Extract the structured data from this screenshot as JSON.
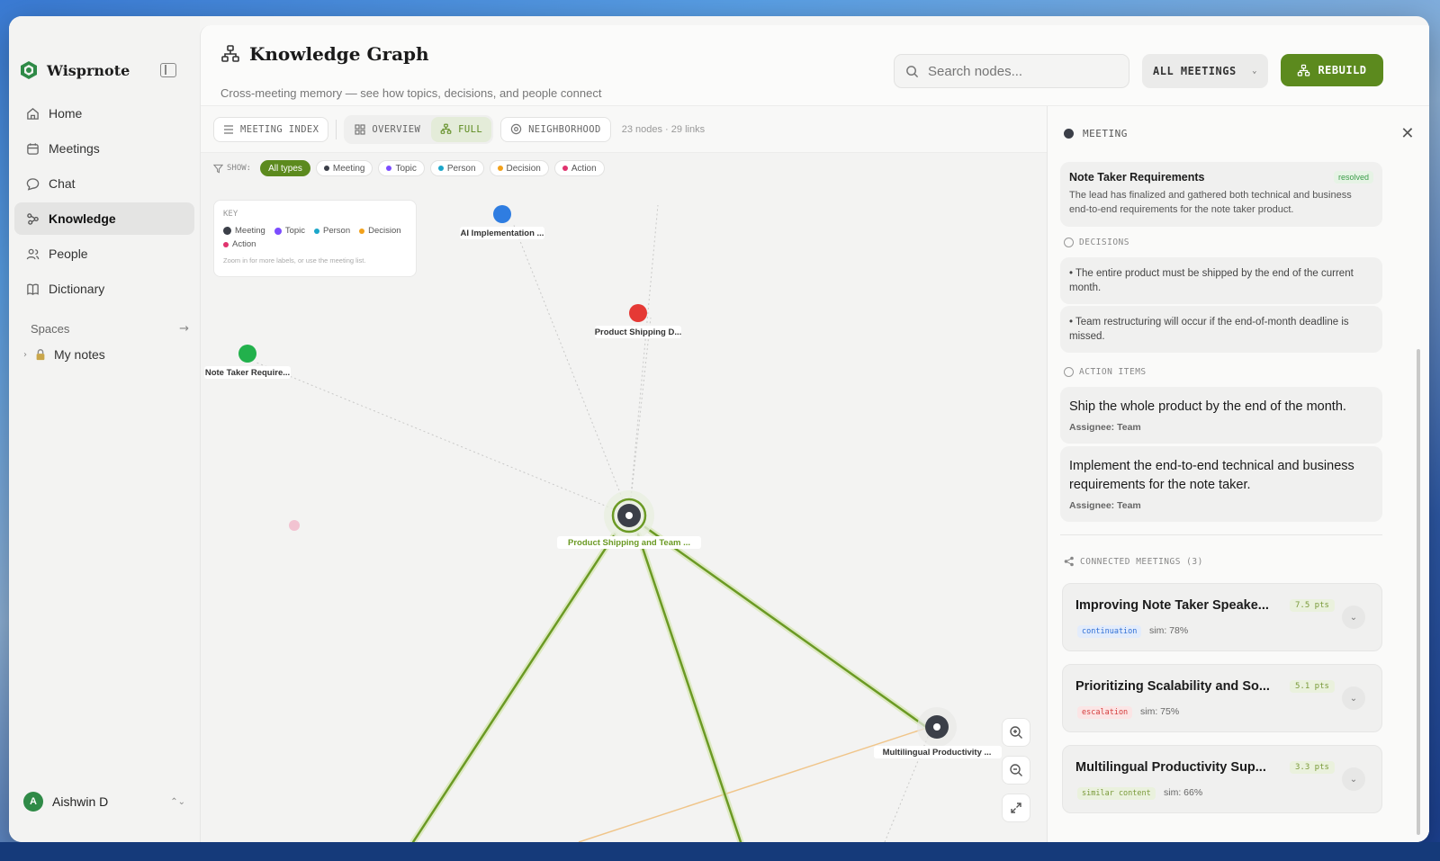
{
  "window": {
    "traffic_lights": [
      "#3fbf4f",
      "#f5b82b",
      "#ee5a50"
    ]
  },
  "sidebar": {
    "brand": "Wisprnote",
    "items": [
      {
        "label": "Home",
        "icon": "home-icon"
      },
      {
        "label": "Meetings",
        "icon": "calendar-icon"
      },
      {
        "label": "Chat",
        "icon": "chat-icon"
      },
      {
        "label": "Knowledge",
        "icon": "knowledge-icon",
        "active": true
      },
      {
        "label": "People",
        "icon": "people-icon"
      },
      {
        "label": "Dictionary",
        "icon": "book-icon"
      }
    ],
    "spaces_label": "Spaces",
    "my_notes": "My notes",
    "user": {
      "initial": "A",
      "name": "Aishwin D"
    }
  },
  "header": {
    "title": "Knowledge Graph",
    "subtitle": "Cross-meeting memory — see how topics, decisions, and people connect",
    "search_placeholder": "Search nodes...",
    "filter_label": "ALL MEETINGS",
    "rebuild_label": "REBUILD",
    "accent": "#5c8a1e"
  },
  "toolbar": {
    "meeting_index": "MEETING INDEX",
    "overview": "OVERVIEW",
    "full": "FULL",
    "neighborhood": "NEIGHBORHOOD",
    "stats": "23 nodes · 29 links",
    "show_label": "SHOW:",
    "chips": [
      {
        "label": "All types",
        "color": ""
      },
      {
        "label": "Meeting",
        "color": "#3b3f48"
      },
      {
        "label": "Topic",
        "color": "#7c4dff"
      },
      {
        "label": "Person",
        "color": "#1ba6c9"
      },
      {
        "label": "Decision",
        "color": "#f2a11b"
      },
      {
        "label": "Action",
        "color": "#e0336e"
      }
    ]
  },
  "key": {
    "title": "KEY",
    "items": [
      {
        "label": "Meeting",
        "color": "#3b3f48"
      },
      {
        "label": "Topic",
        "color": "#7c4dff"
      },
      {
        "label": "Person",
        "color": "#1ba6c9"
      },
      {
        "label": "Decision",
        "color": "#f2a11b"
      },
      {
        "label": "Action",
        "color": "#e0336e"
      }
    ],
    "hint": "Zoom in for more labels, or use the meeting list."
  },
  "graph": {
    "nodes": [
      {
        "label": "AI Implementation ...",
        "color": "#2f7de1"
      },
      {
        "label": "Product Shipping D...",
        "color": "#e53935"
      },
      {
        "label": "Note Taker Require...",
        "color": "#22b14c"
      },
      {
        "label": "Product Shipping and Team ...",
        "color": "#3b3f48"
      },
      {
        "label": "Multilingual Productivity ...",
        "color": "#3b3f48"
      }
    ]
  },
  "detail": {
    "type_label": "MEETING",
    "summary": {
      "title": "Note Taker Requirements",
      "status": "resolved",
      "description": "The lead has finalized and gathered both technical and business end-to-end requirements for the note taker product."
    },
    "decisions_label": "DECISIONS",
    "decisions": [
      "• The entire product must be shipped by the end of the current month.",
      "• Team restructuring will occur if the end-of-month deadline is missed."
    ],
    "actions_label": "ACTION ITEMS",
    "actions": [
      {
        "title": "Ship the whole product by the end of the month.",
        "assignee": "Assignee: Team"
      },
      {
        "title": "Implement the end-to-end technical and business requirements for the note taker.",
        "assignee": "Assignee: Team"
      }
    ],
    "connected_label": "CONNECTED MEETINGS (3)",
    "connected": [
      {
        "title": "Improving Note Taker Speake...",
        "pts": "7.5 pts",
        "tag": "continuation",
        "sim": "sim: 78%"
      },
      {
        "title": "Prioritizing Scalability and So...",
        "pts": "5.1 pts",
        "tag": "escalation",
        "sim": "sim: 75%"
      },
      {
        "title": "Multilingual Productivity Sup...",
        "pts": "3.3 pts",
        "tag": "similar content",
        "sim": "sim: 66%"
      }
    ]
  }
}
